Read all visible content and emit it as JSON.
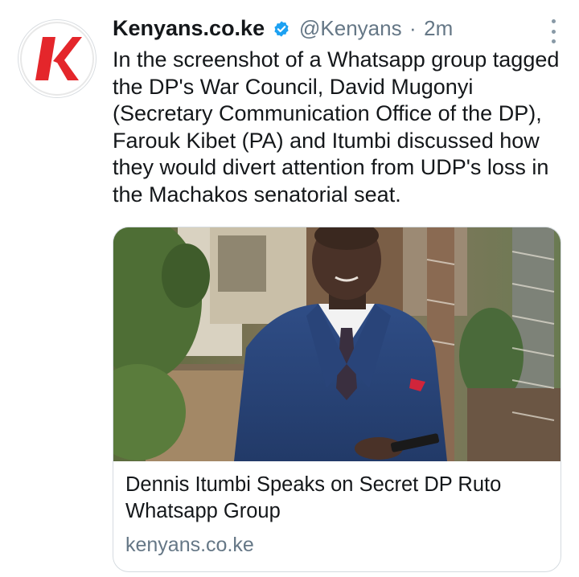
{
  "tweet": {
    "author_name": "Kenyans.co.ke",
    "handle": "@Kenyans",
    "separator": "·",
    "time": "2m",
    "avatar_letter": "K",
    "text": "In the screenshot of a Whatsapp group tagged the DP's War Council, David Mugonyi (Secretary Communication Office of the DP), Farouk Kibet (PA) and Itumbi discussed how they would divert attention from UDP's loss in the Machakos senatorial seat."
  },
  "card": {
    "title": "Dennis Itumbi Speaks on Secret DP Ruto Whatsapp Group",
    "domain": "kenyans.co.ke"
  },
  "colors": {
    "brand_red": "#e4262b",
    "verified_blue": "#1da1f2",
    "secondary_text": "#657786",
    "primary_text": "#14171a"
  },
  "icons": {
    "verified": "verified-badge-icon",
    "more": "more-vertical-icon"
  }
}
